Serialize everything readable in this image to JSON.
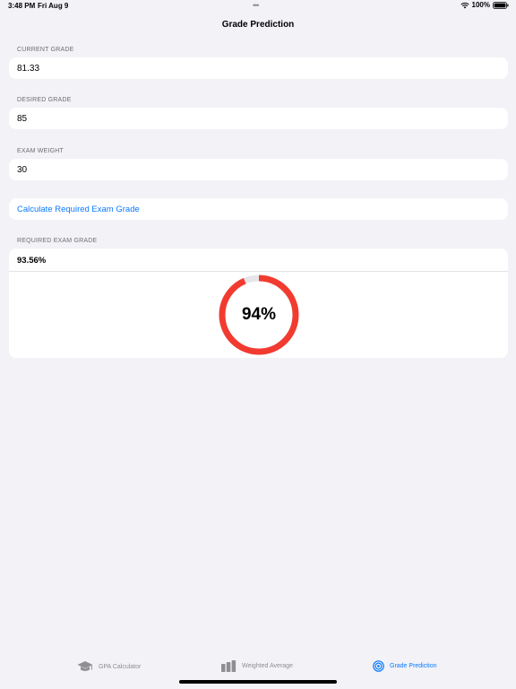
{
  "status_bar": {
    "time": "3:48 PM",
    "date": "Fri Aug 9",
    "battery": "100%"
  },
  "nav": {
    "title": "Grade Prediction"
  },
  "form": {
    "current_grade": {
      "label": "CURRENT GRADE",
      "value": "81.33"
    },
    "desired_grade": {
      "label": "DESIRED GRADE",
      "value": "85"
    },
    "exam_weight": {
      "label": "EXAM WEIGHT",
      "value": "30"
    },
    "calculate_label": "Calculate Required Exam Grade"
  },
  "result": {
    "label": "REQUIRED EXAM GRADE",
    "value": "93.56%",
    "gauge_text": "94%",
    "gauge_fraction": 0.9356,
    "gauge_color": "#f23b30",
    "gauge_track_color": "#e5e5ea"
  },
  "tabs": [
    {
      "label": "GPA Calculator",
      "icon": "graduation-cap-icon"
    },
    {
      "label": "Weighted Average",
      "icon": "bar-chart-icon"
    },
    {
      "label": "Grade Prediction",
      "icon": "target-icon"
    }
  ],
  "colors": {
    "accent": "#0a7aff",
    "background": "#f2f2f7",
    "inactive": "#8e8e93"
  }
}
